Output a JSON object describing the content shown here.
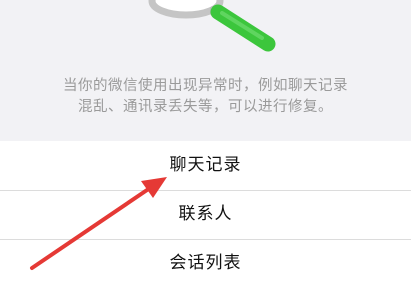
{
  "description": {
    "line1": "当你的微信使用出现异常时，例如聊天记录",
    "line2": "混乱、通讯录丢失等，可以进行修复。"
  },
  "menu": {
    "items": [
      {
        "label": "聊天记录"
      },
      {
        "label": "联系人"
      },
      {
        "label": "会话列表"
      }
    ]
  },
  "colors": {
    "accent_green": "#3cc63c",
    "arrow_red": "#e53935",
    "background_top": "#f2f2f5",
    "description_text": "#9a9a9a"
  },
  "icons": {
    "hero": "repair-tool-icon",
    "pointer": "red-arrow-annotation"
  }
}
